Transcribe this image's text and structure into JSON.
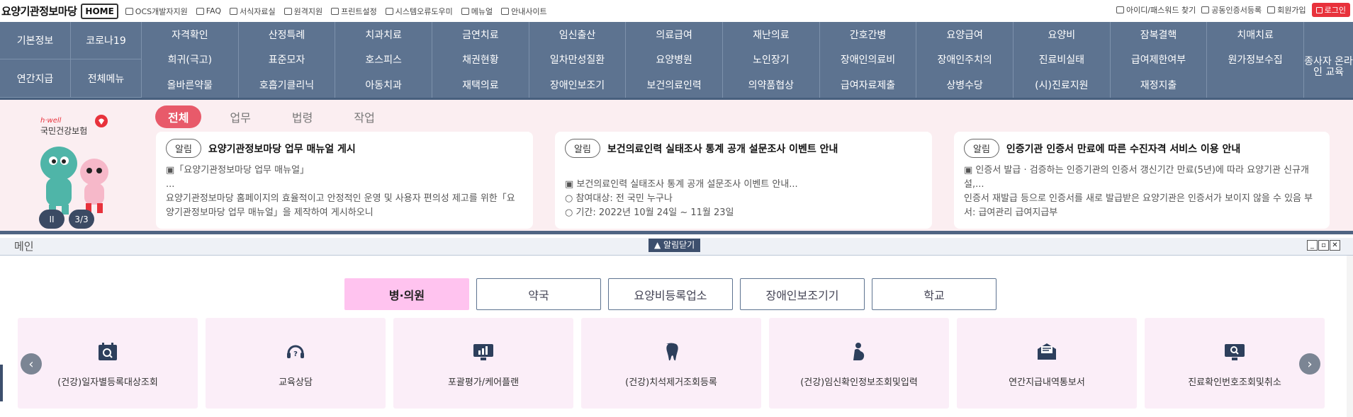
{
  "header": {
    "brand": "요양기관정보마당",
    "home": "HOME",
    "util_links": [
      {
        "label": "OCS개발자지원",
        "icon": "document-icon"
      },
      {
        "label": "FAQ",
        "icon": "chat-icon"
      },
      {
        "label": "서식자료실",
        "icon": "book-icon"
      },
      {
        "label": "원격지원",
        "icon": "monitor-icon"
      },
      {
        "label": "프린트설정",
        "icon": "printer-icon"
      },
      {
        "label": "시스템오류도우미",
        "icon": "printer-icon"
      },
      {
        "label": "메뉴얼",
        "icon": "book-icon"
      },
      {
        "label": "안내사이트",
        "icon": "window-icon"
      }
    ],
    "right_links": [
      {
        "label": "아이디/패스워드 찾기",
        "icon": "phone-icon"
      },
      {
        "label": "공동인증서등록",
        "icon": "shield-icon"
      },
      {
        "label": "회원가입",
        "icon": "person-icon"
      }
    ],
    "login": "로그인"
  },
  "nav": {
    "left": [
      "기본정보",
      "코로나19",
      "연간지급",
      "전체메뉴"
    ],
    "grid": [
      "자격확인",
      "산정특례",
      "치과치료",
      "금연치료",
      "임신출산",
      "의료급여",
      "재난의료",
      "간호간병",
      "요양급여",
      "요양비",
      "잠복결핵",
      "치매치료",
      "희귀(극고)",
      "표준모자",
      "호스피스",
      "채권현황",
      "일차만성질환",
      "요양병원",
      "노인장기",
      "장애인의료비",
      "장애인주치의",
      "진료비실태",
      "급여제한여부",
      "원가정보수집",
      "올바른약물",
      "호흡기클리닉",
      "아동치과",
      "재택의료",
      "장애인보조기",
      "보건의료인력",
      "의약품협상",
      "급여자료제출",
      "상병수당",
      "(시)진료지원",
      "재정지출",
      ""
    ],
    "right": "종사자 온라인 교육"
  },
  "notice": {
    "logo_top": "h·well",
    "logo_main": "국민건강보험",
    "pause": "II",
    "page": "3/3",
    "tabs": [
      "전체",
      "업무",
      "법령",
      "작업"
    ],
    "cards": [
      {
        "badge": "알림",
        "title": "요양기관정보마당 업무 매뉴얼 게시",
        "body": "▣「요양기관정보마당 업무 매뉴얼」\n...\n요양기관정보마당 홈페이지의 효율적이고 안정적인 운영 및 사용자 편의성 제고를 위한「요양기관정보마당 업무 매뉴얼」을 제작하여 게시하오니"
      },
      {
        "badge": "알림",
        "title": "보건의료인력 실태조사 통계 공개 설문조사 이벤트 안내",
        "body": "\n▣ 보건의료인력 실태조사 통계 공개 설문조사 이벤트 안내...\n  ○ 참여대상: 전 국민 누구나\n  ○ 기간: 2022년 10월 24일 ~ 11월 23일"
      },
      {
        "badge": "알림",
        "title": "인증기관 인증서 만료에 따른 수진자격 서비스 이용 안내",
        "body": "  ▣ 인증서 발급 · 검증하는 인증기관의 인증서 갱신기간 만료(5년)에 따라 요양기관 신규개설,...\n     인증서 재발급 등으로 인증서를 새로 발급받은 요양기관은 인증서가 보이지 않을 수 있음 부서: 급여관리 급여지급부"
      }
    ]
  },
  "window": {
    "title": "메인",
    "close_notice": "▲ 알림닫기",
    "controls": [
      "_",
      "▫",
      "✕"
    ]
  },
  "main": {
    "categories": [
      "병·의원",
      "약국",
      "요양비등록업소",
      "장애인보조기기",
      "학교"
    ],
    "quick": [
      {
        "label": "(건강)일자별등록대상조회",
        "icon": "calendar-search-icon"
      },
      {
        "label": "교육상담",
        "icon": "headset-icon"
      },
      {
        "label": "포괄평가/케어플랜",
        "icon": "chart-monitor-icon"
      },
      {
        "label": "(건강)치석제거조회등록",
        "icon": "tooth-icon"
      },
      {
        "label": "(건강)임신확인정보조회및입력",
        "icon": "pregnant-icon"
      },
      {
        "label": "연간지급내역통보서",
        "icon": "envelope-icon"
      },
      {
        "label": "진료확인번호조회및취소",
        "icon": "monitor-search-icon"
      }
    ],
    "prev": "‹",
    "next": "›"
  }
}
